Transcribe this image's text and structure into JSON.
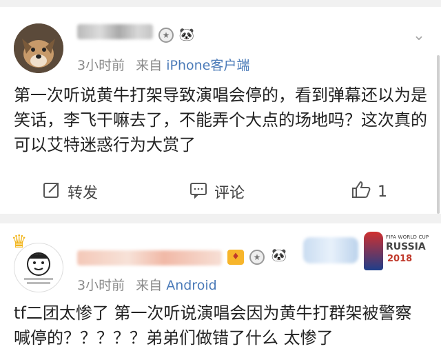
{
  "posts": [
    {
      "time": "3小时前",
      "from_label": "来自",
      "source": "iPhone客户端",
      "content": "第一次听说黄牛打架导致演唱会停的，看到弹幕还以为是笑话，李飞干嘛去了，不能弄个大点的场地吗？这次真的可以艾特迷惑行为大赏了",
      "actions": {
        "repost": "转发",
        "comment": "评论",
        "like_count": "1"
      }
    },
    {
      "time": "3小时前",
      "from_label": "来自",
      "source": "Android",
      "content": "tf二团太惨了  第一次听说演唱会因为黄牛打群架被警察喊停的？？？？？弟弟们做错了什么  太惨了",
      "worldcup": {
        "line1": "FIFA WORLD CUP",
        "line2": "RUSSIA",
        "line3": "2018"
      }
    }
  ],
  "colors": {
    "link": "#4a7ab8",
    "meta": "#8a8a8a",
    "background": "#f1f1f1"
  }
}
